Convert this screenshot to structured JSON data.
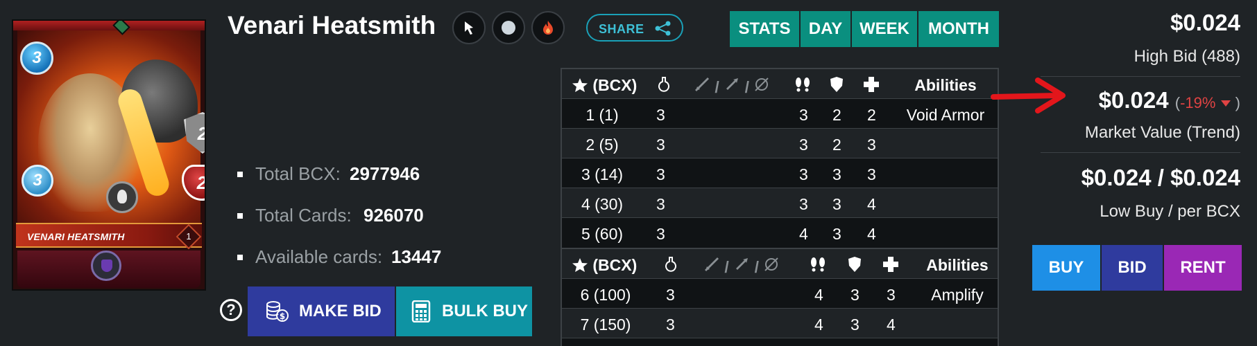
{
  "card": {
    "name": "VENARI HEATSMITH",
    "level": "1",
    "mana": "3",
    "armor": "2",
    "health": "2",
    "magic": "3"
  },
  "title": "Venari Heatsmith",
  "header_icons": [
    "ranged-arrow-icon",
    "neutral-circle-icon",
    "fire-icon"
  ],
  "share_label": "SHARE",
  "tabs": [
    "STATS",
    "DAY",
    "WEEK",
    "MONTH"
  ],
  "stats": {
    "total_bcx_label": "Total BCX:",
    "total_bcx": "2977946",
    "total_cards_label": "Total Cards:",
    "total_cards": "926070",
    "available_label": "Available cards:",
    "available": "13447"
  },
  "actions": {
    "help": "?",
    "make_bid": "MAKE BID",
    "bulk_buy": "BULK BUY"
  },
  "table": {
    "headers": {
      "bcx": "(BCX)",
      "abilities": "Abilities",
      "attack_sep": "/"
    },
    "section1": [
      {
        "level": "1 (1)",
        "mana": "3",
        "speed": "3",
        "armor": "2",
        "health": "2",
        "ability": "Void Armor"
      },
      {
        "level": "2 (5)",
        "mana": "3",
        "speed": "3",
        "armor": "2",
        "health": "3",
        "ability": ""
      },
      {
        "level": "3 (14)",
        "mana": "3",
        "speed": "3",
        "armor": "3",
        "health": "3",
        "ability": ""
      },
      {
        "level": "4 (30)",
        "mana": "3",
        "speed": "3",
        "armor": "3",
        "health": "4",
        "ability": ""
      },
      {
        "level": "5 (60)",
        "mana": "3",
        "speed": "4",
        "armor": "3",
        "health": "4",
        "ability": ""
      }
    ],
    "section2": [
      {
        "level": "6 (100)",
        "mana": "3",
        "speed": "4",
        "armor": "3",
        "health": "3",
        "ability": "Amplify"
      },
      {
        "level": "7 (150)",
        "mana": "3",
        "speed": "4",
        "armor": "3",
        "health": "4",
        "ability": ""
      }
    ]
  },
  "market": {
    "high_bid": "$0.024",
    "high_bid_label": "High Bid (488)",
    "market_value": "$0.024",
    "trend_open": "(",
    "trend": "-19%",
    "trend_close": ")",
    "market_value_label": "Market Value (Trend)",
    "low_buy": "$0.024 / $0.024",
    "low_buy_label": "Low Buy / per BCX"
  },
  "market_actions": {
    "buy": "BUY",
    "bid": "BID",
    "rent": "RENT"
  },
  "colors": {
    "background": "#1f2326",
    "tab_teal": "#0a8f7f",
    "make_bid": "#2f3b9e",
    "bulk_buy": "#0e93a3",
    "buy": "#1e8fe6",
    "bid": "#2f3b9e",
    "rent": "#9a28b5",
    "trend_down": "#e04343",
    "annotation_arrow": "#e3161b"
  }
}
